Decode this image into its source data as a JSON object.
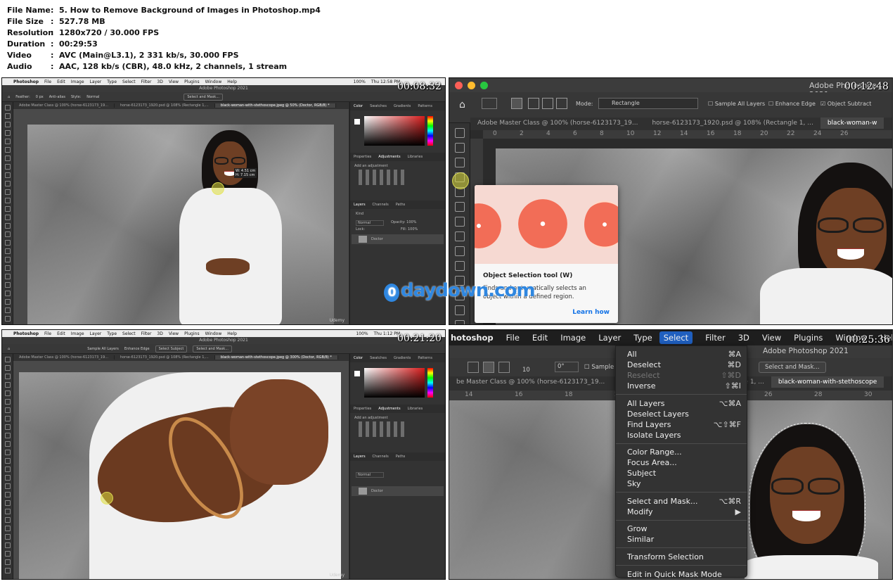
{
  "meta": {
    "rows": [
      {
        "key": "File Name",
        "value": "5. How to Remove Background of Images in Photoshop.mp4"
      },
      {
        "key": "File Size",
        "value": "527.78 MB"
      },
      {
        "key": "Resolution",
        "value": "1280x720 / 30.000 FPS"
      },
      {
        "key": "Duration",
        "value": "00:29:53"
      },
      {
        "key": "Video",
        "value": "AVC (Main@L3.1), 2 331 kb/s, 30.000 FPS"
      },
      {
        "key": "Audio",
        "value": "AAC, 128 kb/s (CBR), 48.0 kHz, 2 channels, 1 stream"
      }
    ],
    "separator": ":"
  },
  "panels": {
    "p1": {
      "timestamp": "00:08:32",
      "menu": [
        "Photoshop",
        "File",
        "Edit",
        "Image",
        "Layer",
        "Type",
        "Select",
        "Filter",
        "3D",
        "View",
        "Plugins",
        "Window",
        "Help"
      ],
      "clock": "Thu 12:58 PM",
      "battery": "100%",
      "title": "Adobe Photoshop 2021",
      "options": [
        "Feather:",
        "0 px",
        "Anti-alias",
        "Style:",
        "Normal",
        "Select and Mask..."
      ],
      "tabs": [
        "Adobe Master Class @ 100% (horse-6123173_19...",
        "horse-6123173_1920.psd @ 108% (Rectangle 1,...",
        "black-woman-with-stethoscope.jpeg @ 50% (Doctor, RGB/8) *"
      ],
      "panel_tabs": [
        "Color",
        "Swatches",
        "Gradients",
        "Patterns"
      ],
      "panel_tabs2": [
        "Properties",
        "Adjustments",
        "Libraries"
      ],
      "adjust_label": "Add an adjustment",
      "layers_tabs": [
        "Layers",
        "Channels",
        "Paths"
      ],
      "layer_kind": "Kind",
      "layer_mode": "Normal",
      "opacity": "Opacity: 100%",
      "lock": "Lock:",
      "fill": "Fill: 100%",
      "layer_name": "Doctor",
      "tooltip": "W: 4.51 cm\nH: 7.15 cm",
      "udemy": "Udemy"
    },
    "p2": {
      "timestamp": "00:12:48",
      "app_title": "Adobe Photoshop 2021",
      "mode_label": "Mode:",
      "mode_value": "Rectangle",
      "checks": [
        "Sample All Layers",
        "Enhance Edge",
        "Object Subtract"
      ],
      "tabs": [
        "Adobe Master Class @ 100% (horse-6123173_19...",
        "horse-6123173_1920.psd @ 108% (Rectangle 1, ...",
        "black-woman-w"
      ],
      "ruler": [
        "0",
        "2",
        "4",
        "6",
        "8",
        "10",
        "12",
        "14",
        "16",
        "18",
        "20",
        "22",
        "24",
        "26"
      ],
      "popup_title": "Object Selection tool (W)",
      "popup_desc": "Finds and automatically selects an object within a defined region.",
      "popup_link": "Learn how"
    },
    "p3": {
      "timestamp": "00:21:20",
      "menu": [
        "Photoshop",
        "File",
        "Edit",
        "Image",
        "Layer",
        "Type",
        "Select",
        "Filter",
        "3D",
        "View",
        "Plugins",
        "Window",
        "Help"
      ],
      "clock": "Thu 1:12 PM",
      "battery": "100%",
      "title": "Adobe Photoshop 2021",
      "options": [
        "Sample All Layers",
        "Enhance Edge",
        "Select Subject",
        "Select and Mask..."
      ],
      "tabs": [
        "Adobe Master Class @ 100% (horse-6123173_19...",
        "horse-6123173_1920.psd @ 108% (Rectangle 1,...",
        "black-woman-with-stethoscope.jpeg @ 300% (Doctor, RGB/8) *"
      ],
      "panel_tabs": [
        "Color",
        "Swatches",
        "Gradients",
        "Patterns"
      ],
      "panel_tabs2": [
        "Properties",
        "Adjustments",
        "Libraries"
      ],
      "adjust_label": "Add an adjustment",
      "layers_tabs": [
        "Layers",
        "Channels",
        "Paths"
      ],
      "layer_mode": "Normal",
      "layer_name": "Doctor",
      "udemy": "Udemy"
    },
    "p4": {
      "timestamp": "00:25:36",
      "menu": [
        "hotoshop",
        "File",
        "Edit",
        "Image",
        "Layer",
        "Type",
        "Select",
        "Filter",
        "3D",
        "View",
        "Plugins",
        "Window",
        "Help"
      ],
      "app_title": "Adobe Photoshop 2021",
      "option_partial": "Sample",
      "select_mask_btn": "Select and Mask...",
      "brush_size": "10",
      "angle": "0°",
      "tabs": [
        "be Master Class @ 100% (horse-6123173_19...",
        "gle 1, ...",
        "black-woman-with-stethoscope"
      ],
      "ruler": [
        "14",
        "16",
        "18",
        "20",
        "22",
        "24",
        "26",
        "28",
        "30"
      ],
      "select_menu": [
        {
          "label": "All",
          "shortcut": "⌘A",
          "disabled": false
        },
        {
          "label": "Deselect",
          "shortcut": "⌘D",
          "disabled": false
        },
        {
          "label": "Reselect",
          "shortcut": "⇧⌘D",
          "disabled": true
        },
        {
          "label": "Inverse",
          "shortcut": "⇧⌘I",
          "disabled": false
        },
        {
          "label": "All Layers",
          "shortcut": "⌥⌘A",
          "disabled": false
        },
        {
          "label": "Deselect Layers",
          "shortcut": "",
          "disabled": false
        },
        {
          "label": "Find Layers",
          "shortcut": "⌥⇧⌘F",
          "disabled": false
        },
        {
          "label": "Isolate Layers",
          "shortcut": "",
          "disabled": false
        },
        {
          "label": "Color Range...",
          "shortcut": "",
          "disabled": false
        },
        {
          "label": "Focus Area...",
          "shortcut": "",
          "disabled": false
        },
        {
          "label": "Subject",
          "shortcut": "",
          "disabled": false
        },
        {
          "label": "Sky",
          "shortcut": "",
          "disabled": false
        },
        {
          "label": "Select and Mask...",
          "shortcut": "⌥⌘R",
          "disabled": false
        },
        {
          "label": "Modify",
          "shortcut": "▶",
          "disabled": false
        },
        {
          "label": "Grow",
          "shortcut": "",
          "disabled": false
        },
        {
          "label": "Similar",
          "shortcut": "",
          "disabled": false
        },
        {
          "label": "Transform Selection",
          "shortcut": "",
          "disabled": false
        },
        {
          "label": "Edit in Quick Mask Mode",
          "shortcut": "",
          "disabled": false
        }
      ]
    }
  },
  "watermark": {
    "icon": "0",
    "text": "daydown.com"
  },
  "colors": {
    "accent": "#1f5fbf",
    "link": "#1473e6",
    "watermark": "#2f87e0"
  }
}
